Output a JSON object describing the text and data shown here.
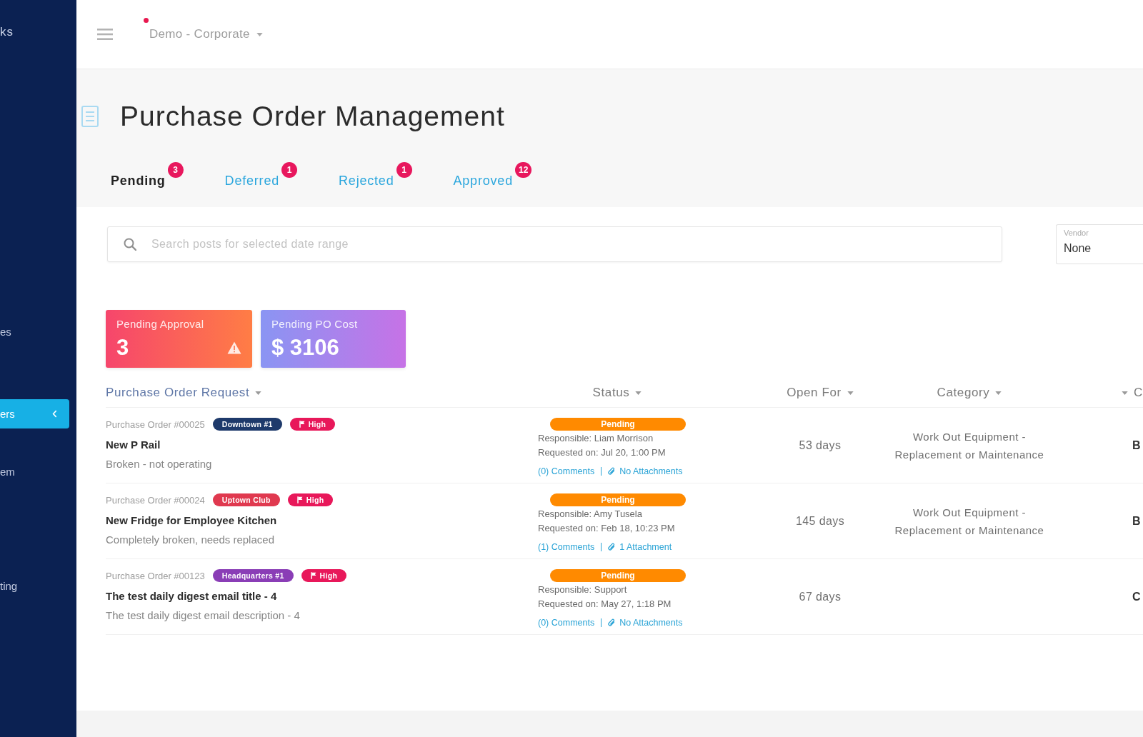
{
  "sidebar": {
    "logo": "ks",
    "items": [
      {
        "label": "es",
        "selected": false
      },
      {
        "label": "ers",
        "selected": true
      },
      {
        "label": "em",
        "selected": false
      },
      {
        "label": "ting",
        "selected": false
      }
    ]
  },
  "top_bar": {
    "account": "Demo - Corporate"
  },
  "page": {
    "title": "Purchase Order Management"
  },
  "tabs": [
    {
      "label": "Pending",
      "count": "3",
      "selected": true
    },
    {
      "label": "Deferred",
      "count": "1",
      "selected": false
    },
    {
      "label": "Rejected",
      "count": "1",
      "selected": false
    },
    {
      "label": "Approved",
      "count": "12",
      "selected": false
    }
  ],
  "search": {
    "placeholder": "Search posts for selected date range"
  },
  "filter": {
    "label": "Vendor",
    "value": "None"
  },
  "stat_cards": [
    {
      "kind": "alert",
      "label": "Pending Approval",
      "value": "3"
    },
    {
      "kind": "cost",
      "label": "Pending PO Cost",
      "value": "$ 3106"
    }
  ],
  "table": {
    "columns": [
      "Purchase Order Request",
      "Status",
      "Open For",
      "Category",
      "C"
    ],
    "rows": [
      {
        "number": "Purchase Order #00025",
        "tags": [
          {
            "kind": "location",
            "label": "Downtown #1",
            "color": "#1e3a6b"
          },
          {
            "kind": "priority",
            "label": "High",
            "color": "#e8185a"
          }
        ],
        "title": "New P Rail",
        "description": "Broken - not operating",
        "status": "Pending",
        "responsible": "Responsible: Liam Morrison",
        "requested": "Requested on: Jul 20, 1:00 PM",
        "comments": "(0) Comments",
        "attachments": "No Attachments",
        "open_for": "53 days",
        "category": "Work Out Equipment - Replacement or Maintenance",
        "column_5": "B"
      },
      {
        "number": "Purchase Order #00024",
        "tags": [
          {
            "kind": "location",
            "label": "Uptown Club",
            "color": "#e0394f"
          },
          {
            "kind": "priority",
            "label": "High",
            "color": "#e8185a"
          }
        ],
        "title": "New Fridge for Employee Kitchen",
        "description": "Completely broken, needs replaced",
        "status": "Pending",
        "responsible": "Responsible: Amy Tusela",
        "requested": "Requested on: Feb 18, 10:23 PM",
        "comments": "(1) Comments",
        "attachments": "1 Attachment",
        "open_for": "145 days",
        "category": "Work Out Equipment - Replacement or Maintenance",
        "column_5": "B"
      },
      {
        "number": "Purchase Order #00123",
        "tags": [
          {
            "kind": "location",
            "label": "Headquarters #1",
            "color": "#8a3db6"
          },
          {
            "kind": "priority",
            "label": "High",
            "color": "#e8185a"
          }
        ],
        "title": "The test daily digest email title - 4",
        "description": "The test daily digest email description - 4",
        "status": "Pending",
        "responsible": "Responsible: Support",
        "requested": "Requested on: May 27, 1:18 PM",
        "comments": "(0) Comments",
        "attachments": "No Attachments",
        "open_for": "67 days",
        "column_5": "C"
      }
    ]
  }
}
